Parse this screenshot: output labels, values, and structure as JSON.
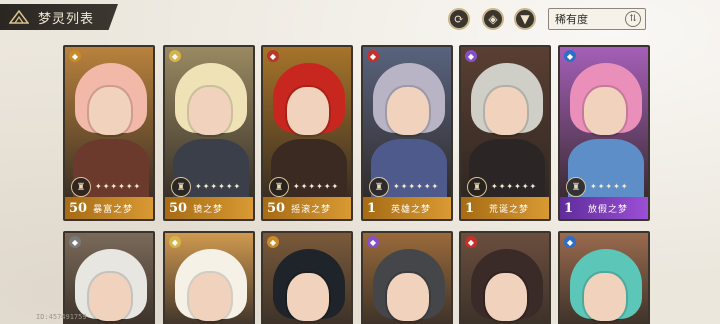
{
  "header": {
    "title": "梦灵列表",
    "buttons": [
      {
        "name": "refresh-icon",
        "glyph": "⟳"
      },
      {
        "name": "badge-icon",
        "glyph": "◈"
      },
      {
        "name": "filter-icon",
        "glyph": "▼"
      }
    ],
    "sort_label": "稀有度",
    "sort_glyph": "⇅"
  },
  "cards_row1": [
    {
      "level": "50",
      "name": "暴富之梦",
      "stars": "✦✦✦✦✦✦",
      "bar": "gold",
      "elem_color": "#c98a2a",
      "hair": "#f2b8a8",
      "body": "#6b3a2c",
      "bg": "#b9823d"
    },
    {
      "level": "50",
      "name": "镜之梦",
      "stars": "✦✦✦✦✦✦",
      "bar": "gold",
      "elem_color": "#d7b248",
      "hair": "#efe2b6",
      "body": "#3b3f4a",
      "bg": "#9a8a62"
    },
    {
      "level": "50",
      "name": "摇滚之梦",
      "stars": "✦✦✦✦✦✦",
      "bar": "gold",
      "elem_color": "#b7372b",
      "hair": "#c8271f",
      "body": "#3a2a22",
      "bg": "#a6742a"
    },
    {
      "level": "1",
      "name": "英雄之梦",
      "stars": "✦✦✦✦✦✦",
      "bar": "gold",
      "elem_color": "#c9302c",
      "hair": "#b8b4c6",
      "body": "#4e5a8c",
      "bg": "#59637e"
    },
    {
      "level": "1",
      "name": "荒诞之梦",
      "stars": "✦✦✦✦✦✦",
      "bar": "gold",
      "elem_color": "#8750c8",
      "hair": "#cfcfc7",
      "body": "#2b2526",
      "bg": "#5a3f33"
    },
    {
      "level": "1",
      "name": "放假之梦",
      "stars": "✦✦✦✦✦",
      "bar": "purple",
      "elem_color": "#2f6ec8",
      "hair": "#e98fb9",
      "body": "#5e8ec7",
      "bg": "#a55fb8"
    }
  ],
  "cards_row2": [
    {
      "elem_color": "#7a7a7a",
      "hair": "#e7e6e1",
      "body": "#5b4d43",
      "bg": "#7a6a5a"
    },
    {
      "elem_color": "#d7b248",
      "hair": "#f6f1e6",
      "body": "#d8a66a",
      "bg": "#d09a50"
    },
    {
      "elem_color": "#c98a2a",
      "hair": "#1e2429",
      "body": "#2e3034",
      "bg": "#7a5a3a"
    },
    {
      "elem_color": "#8750c8",
      "hair": "#44464a",
      "body": "#3a3430",
      "bg": "#9a6a3a"
    },
    {
      "elem_color": "#c9302c",
      "hair": "#3a2a28",
      "body": "#5a2e2e",
      "bg": "#6a4e3e"
    },
    {
      "elem_color": "#2f6ec8",
      "hair": "#5cc7b8",
      "body": "#c23b3b",
      "bg": "#9a6a4e"
    }
  ],
  "uid": "ID:457491759",
  "class_glyph": "♜"
}
